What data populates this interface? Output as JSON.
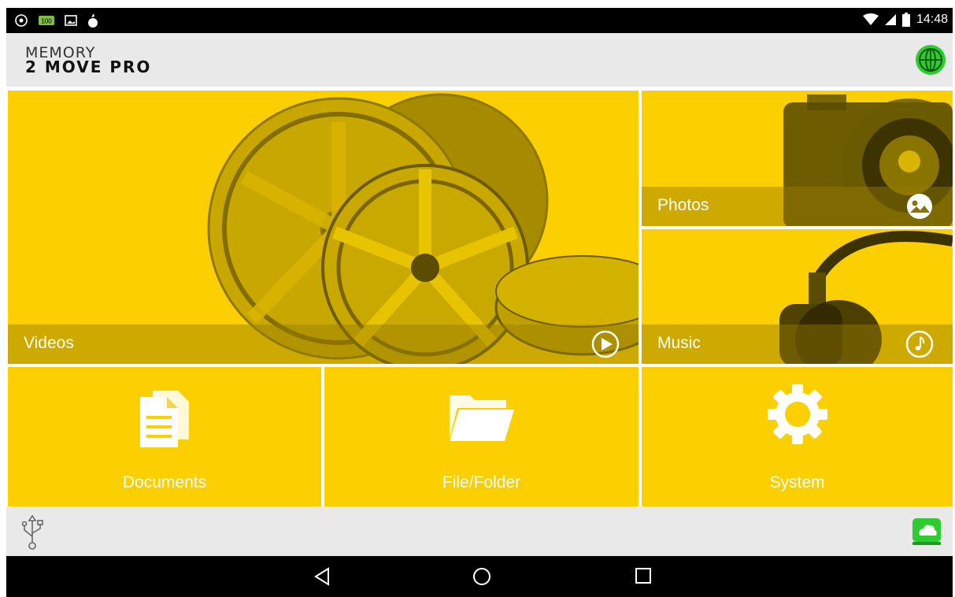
{
  "status_bar": {
    "time": "14:48",
    "left_icons": [
      "vpn-icon",
      "battery-100-icon",
      "image-notification-icon",
      "usb-debug-icon"
    ],
    "right_icons": [
      "wifi-icon",
      "signal-icon",
      "battery-icon"
    ]
  },
  "app_bar": {
    "logo_line1": "MEMORY",
    "logo_line2": "2 MOVE PRO",
    "globe_icon": "globe-icon",
    "globe_color": "#2ecc2e"
  },
  "tiles": {
    "videos": {
      "label": "Videos",
      "icon": "play-icon"
    },
    "photos": {
      "label": "Photos",
      "icon": "photo-icon"
    },
    "music": {
      "label": "Music",
      "icon": "music-note-icon"
    },
    "documents": {
      "label": "Documents",
      "icon": "documents-icon"
    },
    "file_folder": {
      "label": "File/Folder",
      "icon": "folder-icon"
    },
    "system": {
      "label": "System",
      "icon": "gear-icon"
    }
  },
  "bottom_bar": {
    "usb_icon": "usb-icon",
    "cloud_icon": "cloud-drive-icon",
    "cloud_color": "#2ecc2e"
  },
  "nav_bar": {
    "buttons": [
      "back-icon",
      "home-icon",
      "recents-icon"
    ]
  },
  "colors": {
    "accent_yellow": "#fbcf00",
    "bar_gray": "#e9e9e9"
  }
}
